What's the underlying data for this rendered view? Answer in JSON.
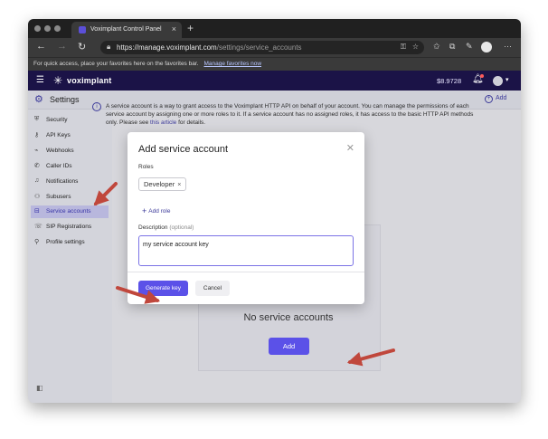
{
  "browser": {
    "tab_title": "Voximplant Control Panel",
    "url_main": "https://manage.voximplant.com",
    "url_path": "/settings/service_accounts",
    "favorites_text": "For quick access, place your favorites here on the favorites bar.",
    "favorites_link": "Manage favorites now"
  },
  "app": {
    "logo": "voximplant",
    "balance": "$8.9728"
  },
  "page": {
    "title": "Settings",
    "add_top": "Add"
  },
  "sidebar": {
    "items": [
      {
        "label": "Security",
        "icon": "shield-icon"
      },
      {
        "label": "API Keys",
        "icon": "key-icon"
      },
      {
        "label": "Webhooks",
        "icon": "webhook-icon"
      },
      {
        "label": "Caller IDs",
        "icon": "phone-icon"
      },
      {
        "label": "Notifications",
        "icon": "bell-icon"
      },
      {
        "label": "Subusers",
        "icon": "users-icon"
      },
      {
        "label": "Service accounts",
        "icon": "service-account-icon",
        "active": true
      },
      {
        "label": "SIP Registrations",
        "icon": "sip-icon"
      },
      {
        "label": "Profile settings",
        "icon": "profile-icon"
      }
    ]
  },
  "info": {
    "text_before": "A service account is a way to grant access to the Voximplant HTTP API on behalf of your account. You can manage the permissions of each service account by assigning one or more roles to it. If a service account has no assigned roles, it has access to the basic HTTP API methods only. Please see ",
    "link": "this article",
    "text_after": " for details."
  },
  "empty": {
    "title": "No service accounts",
    "add_button": "Add"
  },
  "modal": {
    "title": "Add service account",
    "roles_label": "Roles",
    "role_chip": "Developer",
    "add_role": "Add role",
    "description_label": "Description",
    "description_optional": "(optional)",
    "description_value": "my service account key",
    "generate_button": "Generate key",
    "cancel_button": "Cancel"
  },
  "colors": {
    "accent": "#5b51e8",
    "header": "#1b1347",
    "annotation_arrow": "#c0473c"
  }
}
